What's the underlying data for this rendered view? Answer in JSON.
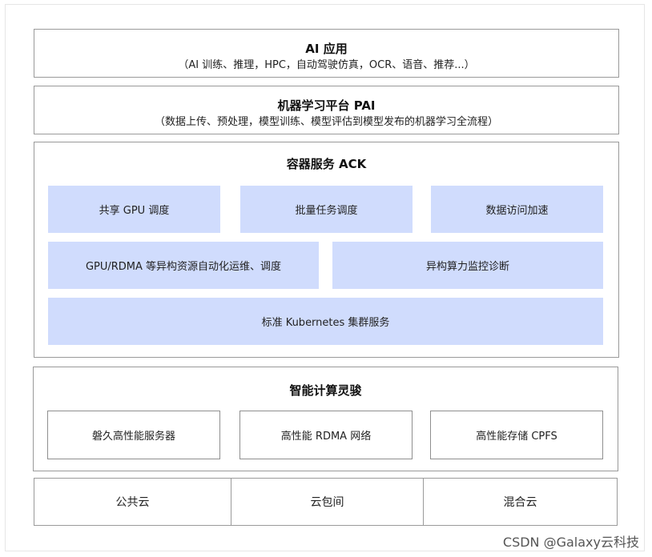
{
  "layers": {
    "ai_app": {
      "title": "AI 应用",
      "subtitle": "（AI 训练、推理，HPC，自动驾驶仿真，OCR、语音、推荐...）"
    },
    "pai": {
      "title": "机器学习平台 PAI",
      "subtitle": "（数据上传、预处理，模型训练、模型评估到模型发布的机器学习全流程）"
    },
    "ack": {
      "title": "容器服务 ACK",
      "row1": [
        "共享 GPU 调度",
        "批量任务调度",
        "数据访问加速"
      ],
      "row2": [
        "GPU/RDMA 等异构资源自动化运维、调度",
        "异构算力监控诊断"
      ],
      "row3": "标准 Kubernetes 集群服务"
    },
    "lingjun": {
      "title": "智能计算灵骏",
      "items": [
        "磐久高性能服务器",
        "高性能 RDMA 网络",
        "高性能存储 CPFS"
      ]
    },
    "clouds": [
      "公共云",
      "云包间",
      "混合云"
    ]
  },
  "watermark": "CSDN @Galaxy云科技"
}
